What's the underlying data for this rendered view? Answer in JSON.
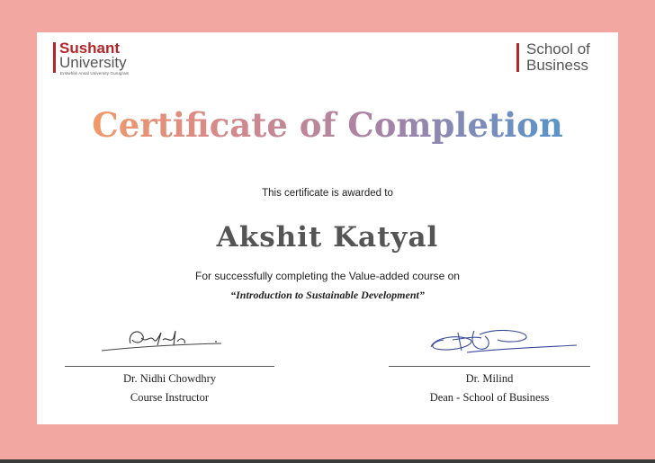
{
  "colors": {
    "background": "#f2a7a1",
    "brand_red": "#b5262a",
    "title_gradient": [
      "#f39a67",
      "#a483a7",
      "#5e93c8"
    ]
  },
  "header": {
    "university_logo": {
      "line1": "Sushant",
      "line2": "University",
      "tagline": "Erstwhile Ansal University Gurugram"
    },
    "school_logo": {
      "line1": "School of",
      "line2": "Business"
    }
  },
  "certificate": {
    "title": "Certificate of Completion",
    "awarded_text": "This certificate is awarded to",
    "recipient": "Akshit Katyal",
    "reason": "For successfully completing the Value-added course on",
    "course": "“Introduction to Sustainable Development”"
  },
  "signatories": [
    {
      "name": "Dr. Nidhi Chowdhry",
      "role": "Course Instructor"
    },
    {
      "name": "Dr. Milind",
      "role": "Dean - School of Business"
    }
  ]
}
